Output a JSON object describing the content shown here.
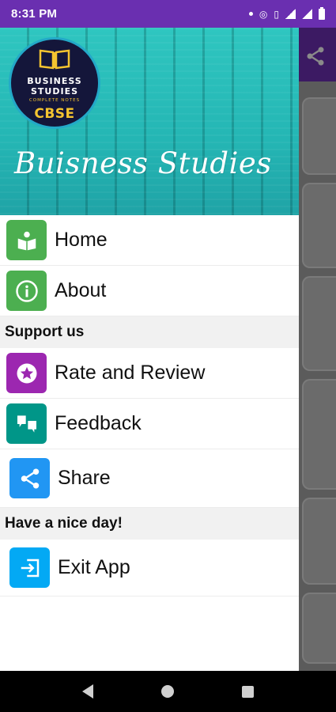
{
  "status_bar": {
    "time": "8:31 PM"
  },
  "header": {
    "logo": {
      "line1": "BUSINESS",
      "line2": "STUDIES",
      "line3": "COMPLETE NOTES",
      "badge": "CBSE"
    },
    "title": "Buisness Studies"
  },
  "menu": {
    "home": {
      "label": "Home",
      "icon": "home-book-icon",
      "color": "#4caf50"
    },
    "about": {
      "label": "About",
      "icon": "info-icon",
      "color": "#4caf50"
    },
    "support_header": "Support us",
    "rate": {
      "label": "Rate and Review",
      "icon": "star-icon",
      "color": "#9c27b0"
    },
    "feedback": {
      "label": "Feedback",
      "icon": "feedback-icon",
      "color": "#009688"
    },
    "share": {
      "label": "Share",
      "icon": "share-icon",
      "color": "#2196f3"
    },
    "day_header": "Have a nice day!",
    "exit": {
      "label": "Exit App",
      "icon": "exit-icon",
      "color": "#03a9f4"
    }
  },
  "colors": {
    "status_bar": "#6a2fb0",
    "header": "#26b8b6"
  }
}
